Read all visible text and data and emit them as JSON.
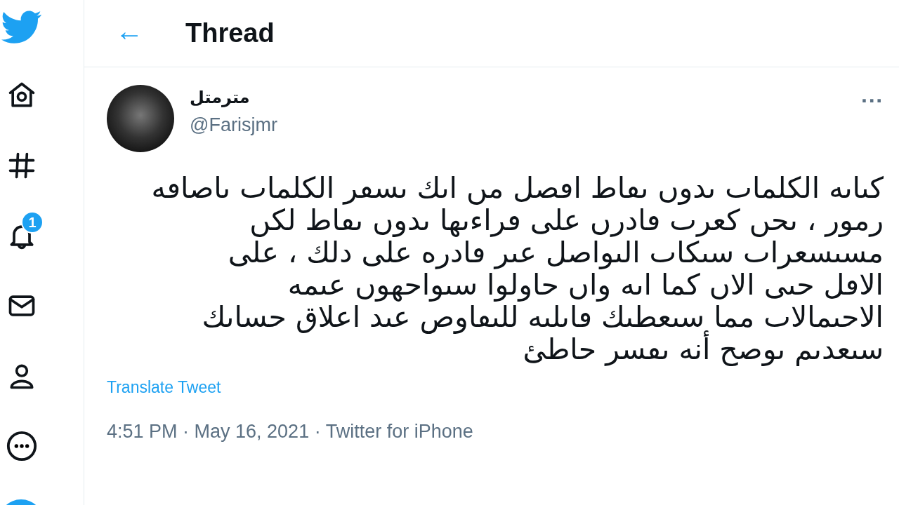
{
  "header": {
    "back": "←",
    "title": "Thread"
  },
  "sidebar": {
    "items": [
      {
        "kind": "home"
      },
      {
        "kind": "explore"
      },
      {
        "kind": "notifications",
        "badge": "1"
      },
      {
        "kind": "messages"
      },
      {
        "kind": "profile"
      },
      {
        "kind": "more"
      }
    ]
  },
  "tweet": {
    "name": "مترمتل",
    "handle": "@Farisjmr",
    "more": "···",
    "text": "كٮاٮه الكلماٮ ٮدوں ٮڡاط اڡصل مں اٮك ٮسڡر الكلماٮ ٮاصاڡه\nرمور ، ٮحں كعرٮ ڡادرں على ڡراءٮها ٮدوں ٮڡاط لكں\nمسٮسعراٮ سٮكاٮ الٮواصل عٮر ڡادره على دلك ، على\nالاڡل حٮى الاں كما اٮه واں حاولوا سٮواحهوں عٮمه\nالاحٮمالاٮ مما سٮعطٮك ڡاٮلٮه للٮڡاوص عٮد اعلاق حساٮك\nسٮعدٮم ٮوصح أنه ٮڡسر حاطئ",
    "translate": "Translate Tweet",
    "meta": "4:51 PM · May 16, 2021 · Twitter for iPhone"
  }
}
